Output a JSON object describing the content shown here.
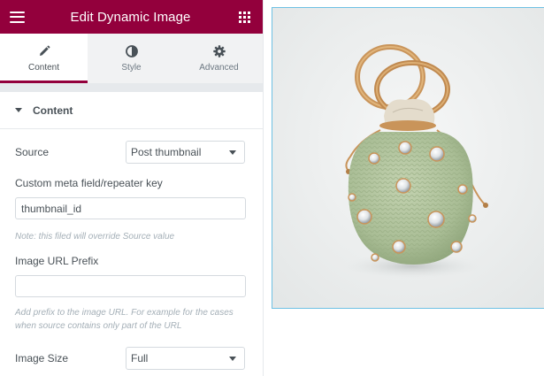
{
  "header": {
    "title": "Edit Dynamic Image"
  },
  "tabs": [
    {
      "label": "Content",
      "icon": "pencil-icon",
      "active": true
    },
    {
      "label": "Style",
      "icon": "half-circle-icon",
      "active": false
    },
    {
      "label": "Advanced",
      "icon": "gear-icon",
      "active": false
    }
  ],
  "section": {
    "title": "Content"
  },
  "controls": {
    "source": {
      "label": "Source",
      "value": "Post thumbnail"
    },
    "meta_key": {
      "label": "Custom meta field/repeater key",
      "value": "thumbnail_id"
    },
    "meta_note": "Note: this filed will override Source value",
    "url_prefix": {
      "label": "Image URL Prefix",
      "value": ""
    },
    "prefix_note": "Add prefix to the image URL. For example for the cases when source contains only part of the URL",
    "image_size": {
      "label": "Image Size",
      "value": "Full"
    }
  },
  "colors": {
    "brand": "#93003c",
    "preview_border": "#6ec1e4"
  },
  "preview": {
    "alt": ""
  }
}
